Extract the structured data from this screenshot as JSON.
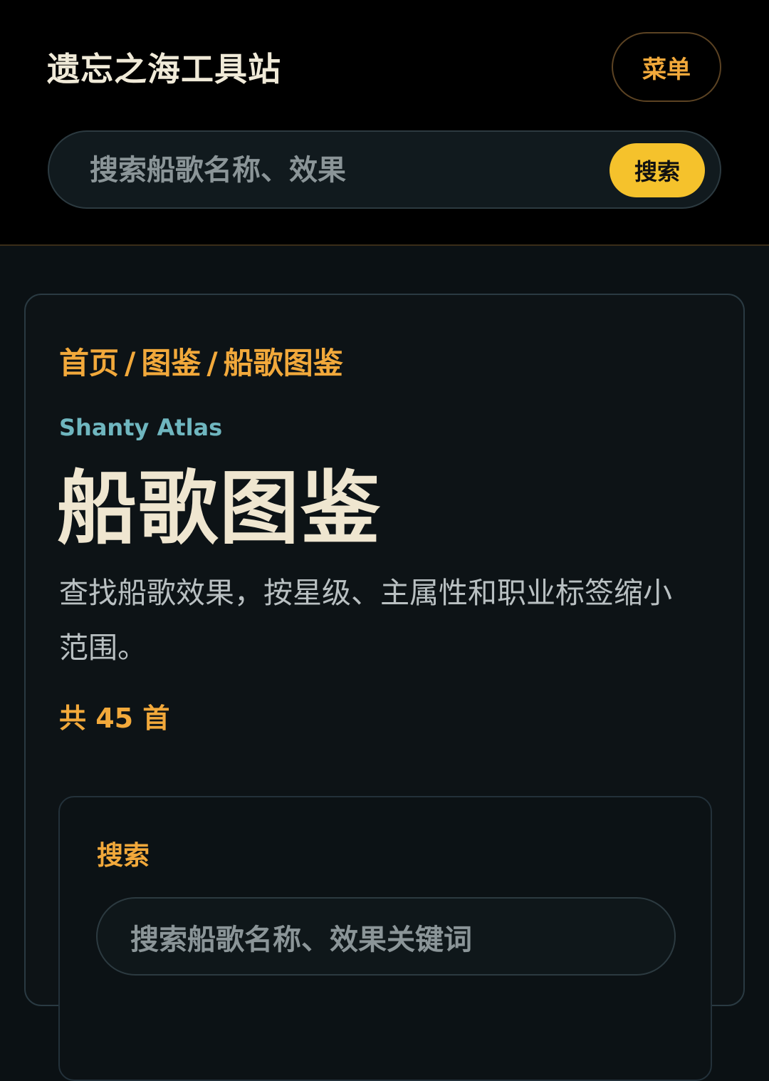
{
  "header": {
    "brand": "遗忘之海工具站",
    "menu_label": "菜单",
    "search": {
      "placeholder": "搜索船歌名称、效果",
      "button_label": "搜索"
    }
  },
  "main": {
    "breadcrumb": {
      "items": [
        "首页",
        "图鉴",
        "船歌图鉴"
      ],
      "separator": "/"
    },
    "eyebrow": "Shanty Atlas",
    "title": "船歌图鉴",
    "description": "查找船歌效果，按星级、主属性和职业标签缩小范围。",
    "count_text": "共 45 首",
    "filter": {
      "label": "搜索",
      "input_placeholder": "搜索船歌名称、效果关键词"
    }
  },
  "colors": {
    "accent": "#f2a93b",
    "search_button": "#f5c22c",
    "eyebrow": "#6fb6bf",
    "title": "#efe6d0",
    "background": "#0b1114"
  }
}
